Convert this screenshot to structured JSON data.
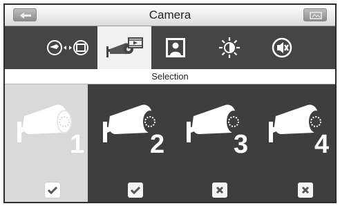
{
  "titlebar": {
    "title": "Camera",
    "left_icon": "back-arrow-icon",
    "right_icon": "menu-icon"
  },
  "toolbar": {
    "items": [
      {
        "id": "camera-switch",
        "icon": "camera-switch-icon",
        "selected": false
      },
      {
        "id": "camera-selection",
        "icon": "camera-record-icon",
        "selected": true
      },
      {
        "id": "picture",
        "icon": "picture-icon",
        "selected": false
      },
      {
        "id": "brightness",
        "icon": "brightness-icon",
        "selected": false
      },
      {
        "id": "volume-mute",
        "icon": "mute-icon",
        "selected": false
      }
    ]
  },
  "section": {
    "label": "Selection"
  },
  "cameras": [
    {
      "number": "1",
      "checked": true,
      "active": true
    },
    {
      "number": "2",
      "checked": true,
      "active": false
    },
    {
      "number": "3",
      "checked": false,
      "active": false
    },
    {
      "number": "4",
      "checked": false,
      "active": false
    }
  ],
  "colors": {
    "dark_bg": "#3e3e3e",
    "selected_bg": "#f1f1f1",
    "active_cell": "#d9d9d9",
    "check_mark": "#555555"
  }
}
